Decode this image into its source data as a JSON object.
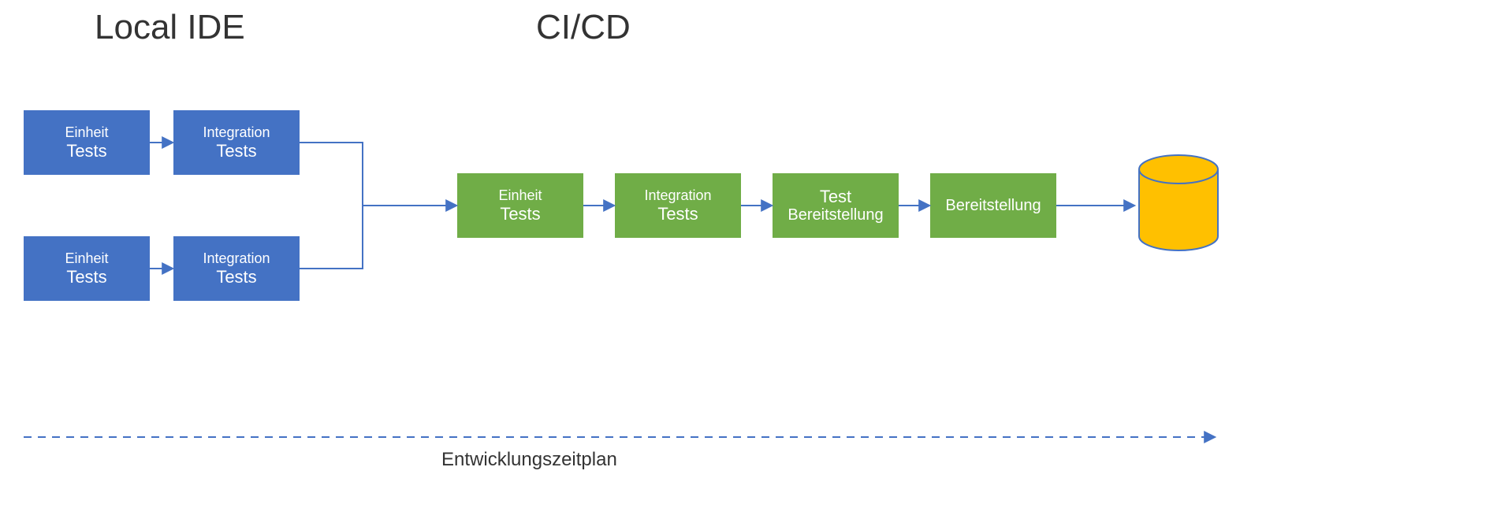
{
  "headings": {
    "localIde": "Local IDE",
    "cicd": "CI/CD"
  },
  "localBoxes": {
    "unit1": {
      "line1": "Einheit",
      "line2": "Tests"
    },
    "int1": {
      "line1": "Integration",
      "line2": "Tests"
    },
    "unit2": {
      "line1": "Einheit",
      "line2": "Tests"
    },
    "int2": {
      "line1": "Integration",
      "line2": "Tests"
    }
  },
  "cicdBoxes": {
    "unit": {
      "line1": "Einheit",
      "line2": "Tests"
    },
    "int": {
      "line1": "Integration",
      "line2": "Tests"
    },
    "testDep": {
      "line1": "Test",
      "line2": "Bereitstellung"
    },
    "dep": {
      "line1": "",
      "line2": "Bereitstellung"
    }
  },
  "timelineLabel": "Entwicklungszeitplan",
  "colors": {
    "blueFill": "#4472C4",
    "greenFill": "#70AD47",
    "arrowStroke": "#4472C4",
    "dbFill": "#FFC000",
    "dbStroke": "#4472C4"
  }
}
